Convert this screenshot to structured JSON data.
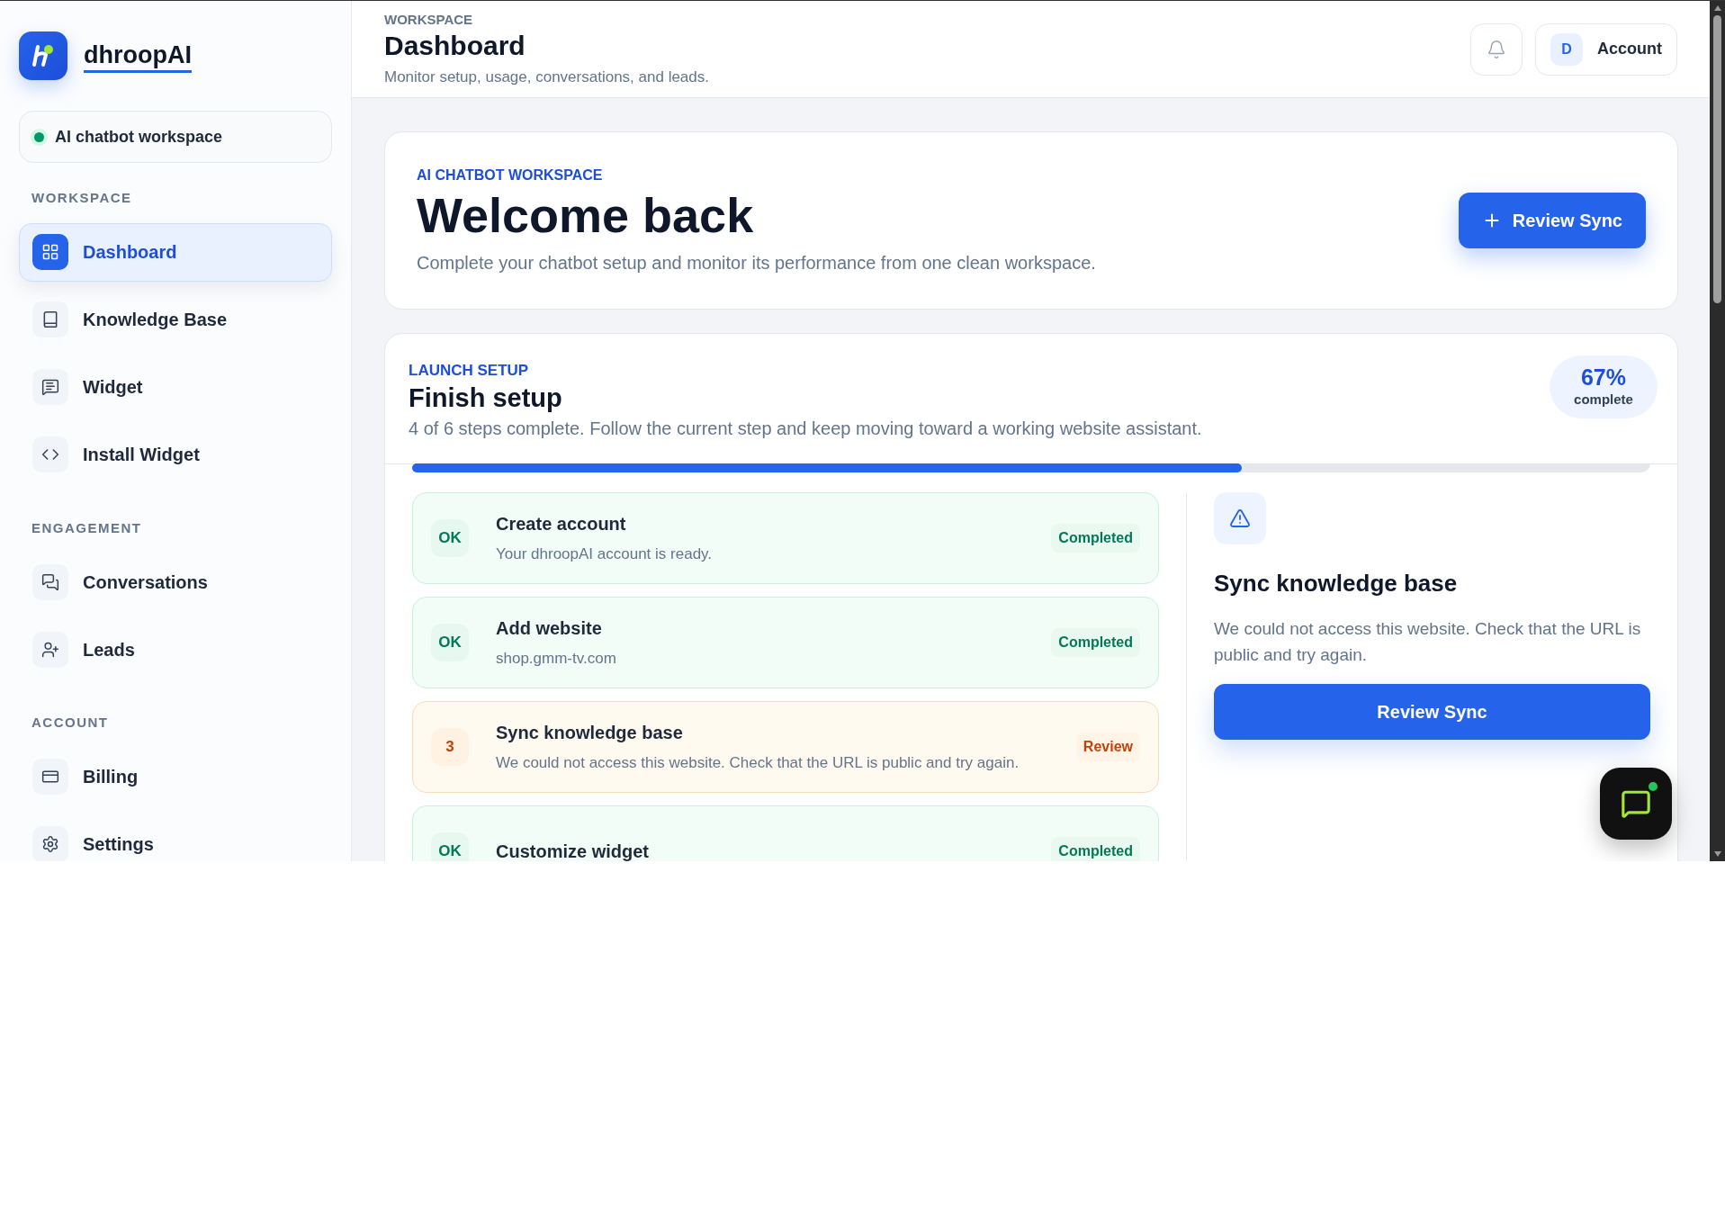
{
  "brand": {
    "name": "dhroopAI"
  },
  "workspace_chip": {
    "label": "AI chatbot workspace"
  },
  "sidebar": {
    "sections": [
      {
        "heading": "WORKSPACE",
        "items": [
          {
            "label": "Dashboard",
            "selected": true
          },
          {
            "label": "Knowledge Base",
            "selected": false
          },
          {
            "label": "Widget",
            "selected": false
          },
          {
            "label": "Install Widget",
            "selected": false
          }
        ]
      },
      {
        "heading": "ENGAGEMENT",
        "items": [
          {
            "label": "Conversations",
            "selected": false
          },
          {
            "label": "Leads",
            "selected": false
          }
        ]
      },
      {
        "heading": "ACCOUNT",
        "items": [
          {
            "label": "Billing",
            "selected": false
          },
          {
            "label": "Settings",
            "selected": false
          }
        ]
      }
    ]
  },
  "header": {
    "eyebrow": "WORKSPACE",
    "title": "Dashboard",
    "subtitle": "Monitor setup, usage, conversations, and leads.",
    "account": {
      "initial": "D",
      "label": "Account"
    }
  },
  "welcome": {
    "eyebrow": "AI CHATBOT WORKSPACE",
    "title": "Welcome back",
    "text": "Complete your chatbot setup and monitor its performance from one clean workspace.",
    "button": "Review Sync"
  },
  "setup": {
    "eyebrow": "LAUNCH SETUP",
    "title": "Finish setup",
    "text": "4 of 6 steps complete. Follow the current step and keep moving toward a working website assistant.",
    "percent": "67%",
    "percent_label": "complete",
    "level": 0.67,
    "steps": [
      {
        "kind": "completed",
        "badge": "OK",
        "title": "Create account",
        "subtitle": "Your dhroopAI account is ready.",
        "status": "Completed"
      },
      {
        "kind": "completed",
        "badge": "OK",
        "title": "Add website",
        "subtitle": "shop.gmm-tv.com",
        "status": "Completed"
      },
      {
        "kind": "review",
        "badge": "3",
        "title": "Sync knowledge base",
        "subtitle": "We could not access this website. Check that the URL is public and try again.",
        "status": "Review"
      },
      {
        "kind": "completed",
        "badge": "OK",
        "title": "Customize widget",
        "status": "Completed"
      }
    ],
    "detail": {
      "title": "Sync knowledge base",
      "text": "We could not access this website. Check that the URL is public and try again.",
      "button": "Review Sync"
    }
  }
}
